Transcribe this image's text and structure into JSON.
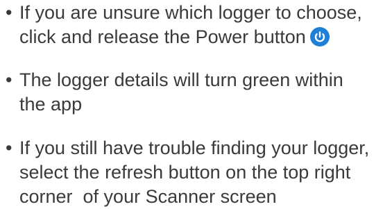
{
  "bullet_char": "•",
  "items": [
    {
      "lines": [
        "If you are unsure which logger to choose,",
        "click and release the Power button"
      ],
      "icon": "power-icon",
      "icon_color": "#1e7fd6"
    },
    {
      "lines": [
        "The logger details will turn green within",
        "the app"
      ]
    },
    {
      "lines": [
        "If you still have trouble finding your logger,",
        "select the refresh button on the top right",
        "corner  of your Scanner screen"
      ]
    }
  ],
  "colors": {
    "text": "#3a3a3a",
    "accent": "#1e7fd6"
  }
}
